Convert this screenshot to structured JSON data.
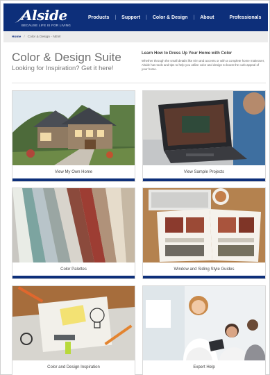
{
  "header": {
    "logo_text": "Alside",
    "logo_tagline": "BECAUSE LIFE IS FOR LIVING",
    "nav": [
      "Products",
      "Support",
      "Color & Design",
      "About",
      "Professionals"
    ]
  },
  "breadcrumb": {
    "home": "Home",
    "current": "Color & Design - NEW"
  },
  "intro": {
    "title": "Color & Design Suite",
    "subtitle": "Looking for Inspiration? Get it here!",
    "heading": "Learn How to Dress Up Your Home with Color",
    "body": "Whether through the small details like trim and accents or with a complete home makeover, Alside has tools and tips to help you utilize color and design to boost the curb appeal of your home."
  },
  "cards": [
    {
      "label": "View My Own Home",
      "image": "house-exterior-photo"
    },
    {
      "label": "View Sample Projects",
      "image": "laptop-photo"
    },
    {
      "label": "Color Palettes",
      "image": "siding-swatches-photo"
    },
    {
      "label": "Window and Siding Style Guides",
      "image": "style-guide-book-photo"
    },
    {
      "label": "Color and Design Inspiration",
      "image": "idea-sketch-photo"
    },
    {
      "label": "Expert Help",
      "image": "expert-consultation-photo"
    }
  ],
  "colors": {
    "brand_blue": "#0d2f7a",
    "breadcrumb_bg": "#ececec"
  }
}
